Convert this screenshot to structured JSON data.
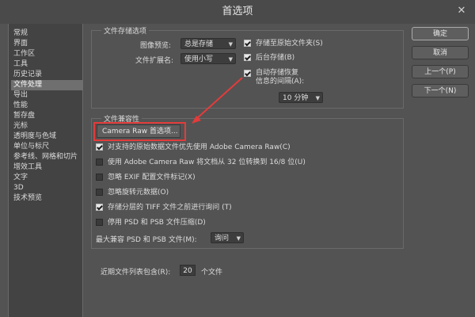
{
  "window": {
    "title": "首选项"
  },
  "sidebar": {
    "items": [
      {
        "label": "常规"
      },
      {
        "label": "界面"
      },
      {
        "label": "工作区"
      },
      {
        "label": "工具"
      },
      {
        "label": "历史记录"
      },
      {
        "label": "文件处理"
      },
      {
        "label": "导出"
      },
      {
        "label": "性能"
      },
      {
        "label": "暂存盘"
      },
      {
        "label": "光标"
      },
      {
        "label": "透明度与色域"
      },
      {
        "label": "单位与标尺"
      },
      {
        "label": "参考线、网格和切片"
      },
      {
        "label": "增效工具"
      },
      {
        "label": "文字"
      },
      {
        "label": "3D"
      },
      {
        "label": "技术预览"
      }
    ],
    "selected": "文件处理"
  },
  "file_saving": {
    "group_label": "文件存储选项",
    "image_preview_label": "图像预览:",
    "image_preview_value": "总是存储",
    "extension_label": "文件扩展名:",
    "extension_value": "使用小写",
    "save_to_original_folder": "存储至原始文件夹(S)",
    "background_save": "后台存储(B)",
    "auto_save_line1": "自动存储恢复",
    "auto_save_line2": "信息的间隔(A):",
    "interval_value": "10 分钟"
  },
  "compatibility": {
    "group_label": "文件兼容性",
    "camera_raw_button": "Camera Raw 首选项...",
    "options": [
      {
        "label": "对支持的原始数据文件优先使用 Adobe Camera Raw(C)",
        "checked": true
      },
      {
        "label": "使用 Adobe Camera Raw 将文档从 32 位转换到 16/8 位(U)",
        "checked": false
      },
      {
        "label": "忽略 EXIF 配置文件标记(X)",
        "checked": false
      },
      {
        "label": "忽略旋转元数据(O)",
        "checked": false
      },
      {
        "label": "存储分层的 TIFF 文件之前进行询问 (T)",
        "checked": true
      },
      {
        "label": "停用 PSD 和 PSB 文件压缩(D)",
        "checked": false
      }
    ],
    "max_compat_label": "最大兼容 PSD 和 PSB 文件(M):",
    "max_compat_value": "询问"
  },
  "recent_files": {
    "label": "近期文件列表包含(R):",
    "value": "20",
    "unit": "个文件"
  },
  "buttons": {
    "ok": "确定",
    "cancel": "取消",
    "prev": "上一个(P)",
    "next": "下一个(N)"
  },
  "colors": {
    "highlight": "#e33b3b",
    "background": "#535353"
  }
}
